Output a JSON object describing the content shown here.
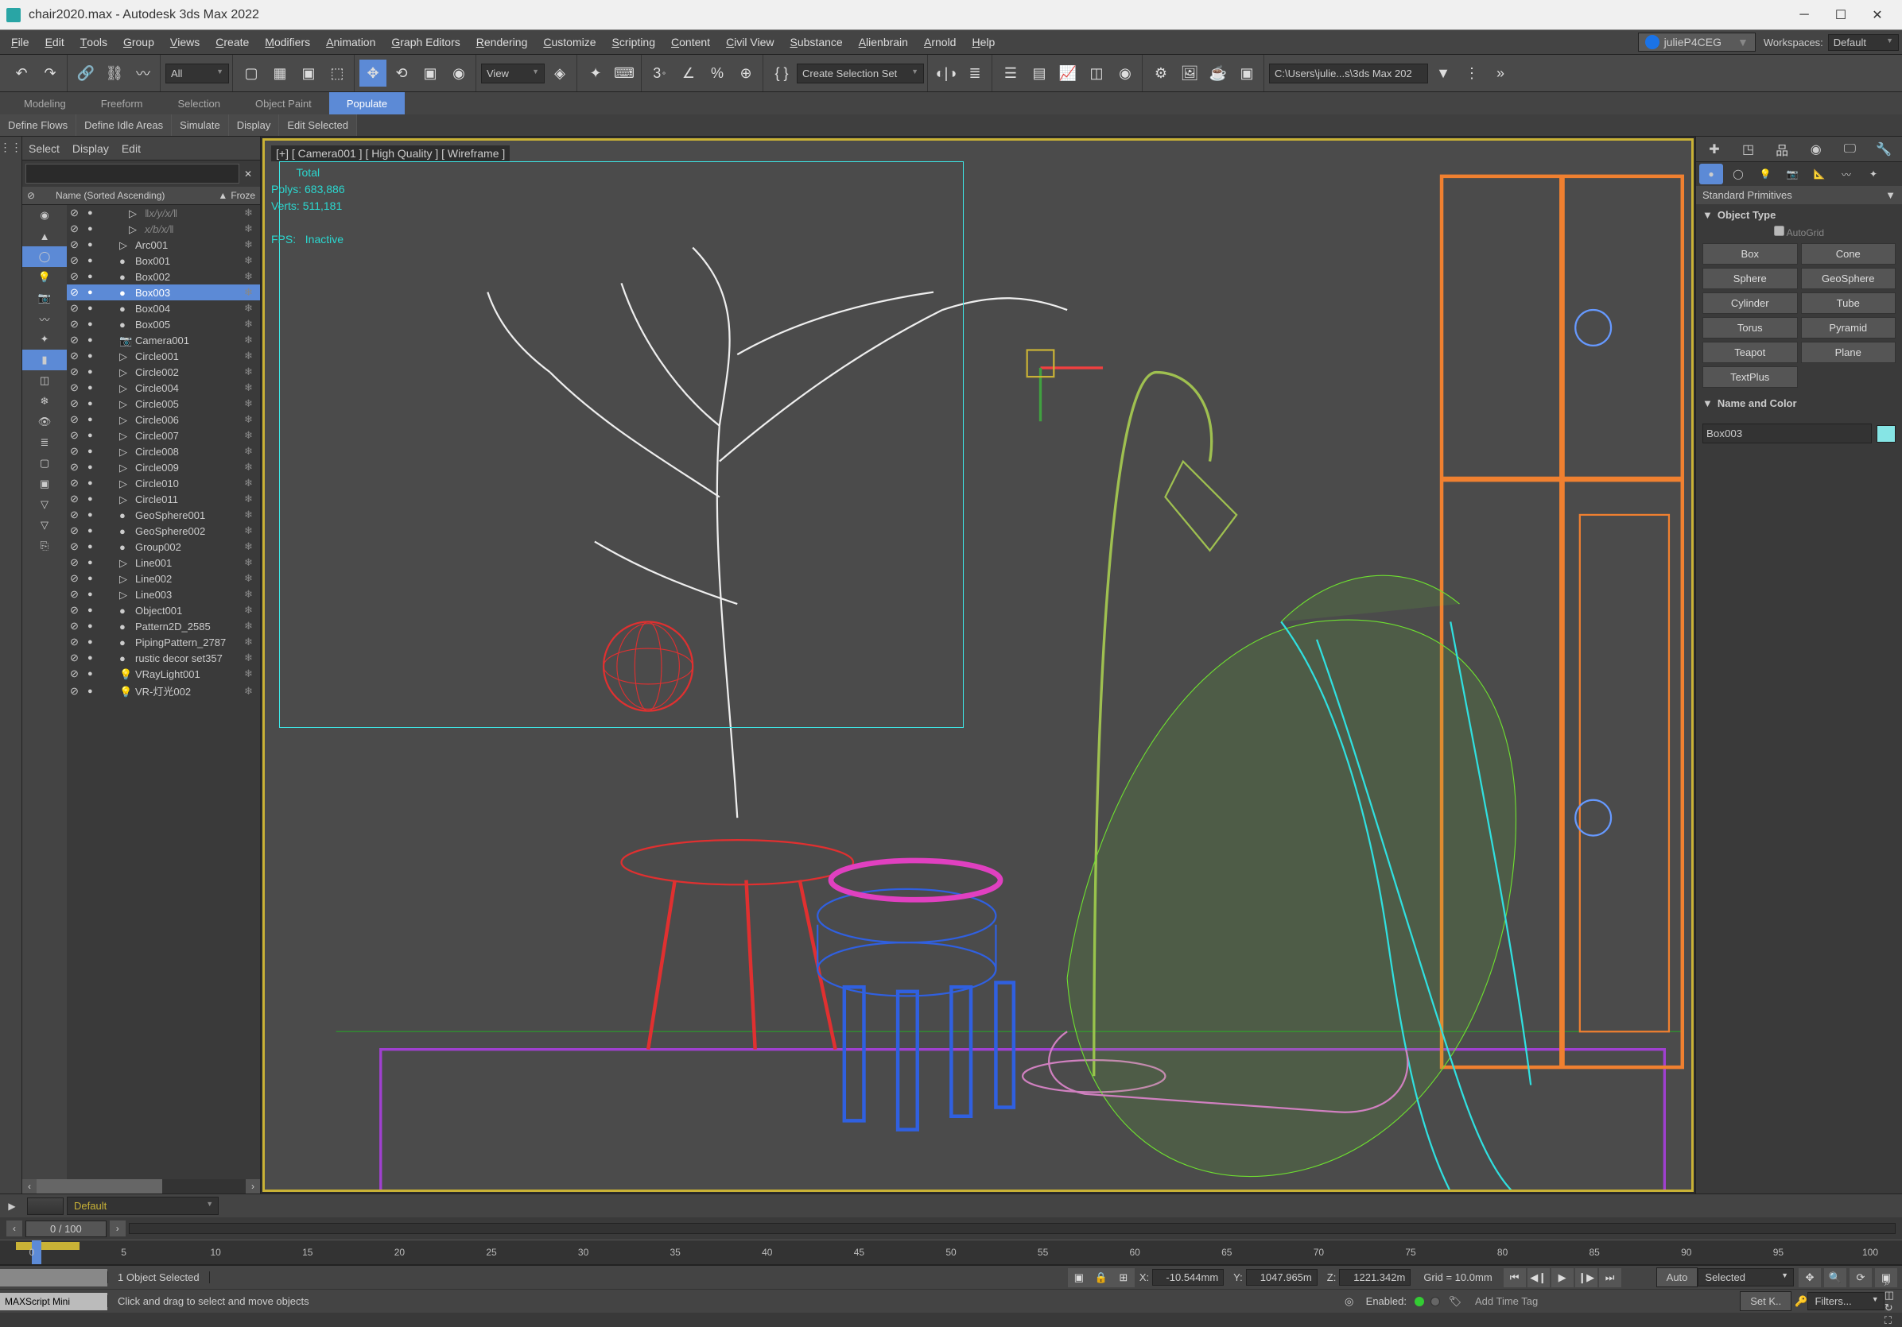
{
  "window": {
    "title": "chair2020.max - Autodesk 3ds Max 2022"
  },
  "menu": [
    "File",
    "Edit",
    "Tools",
    "Group",
    "Views",
    "Create",
    "Modifiers",
    "Animation",
    "Graph Editors",
    "Rendering",
    "Customize",
    "Scripting",
    "Content",
    "Civil View",
    "Substance",
    "Alienbrain",
    "Arnold",
    "Help"
  ],
  "login": {
    "user": "julieP4CEG"
  },
  "workspaces": {
    "label": "Workspaces:",
    "value": "Default"
  },
  "toolbar": {
    "all_dropdown": "All",
    "view_dropdown": "View",
    "create_sel_set": "Create Selection Set",
    "file_path": "C:\\Users\\julie...s\\3ds Max 202"
  },
  "ribbon": {
    "tabs": [
      "Modeling",
      "Freeform",
      "Selection",
      "Object Paint",
      "Populate"
    ],
    "active": "Populate",
    "sub": [
      "Define Flows",
      "Define Idle Areas",
      "Simulate",
      "Display",
      "Edit Selected"
    ]
  },
  "scene_explorer": {
    "menus": [
      "Select",
      "Display",
      "Edit"
    ],
    "col_header": "Name (Sorted Ascending)",
    "col_frozen": "Froze",
    "items": [
      {
        "name": "‖x/y/x/‖",
        "italic": true,
        "selected": false,
        "indent": 2,
        "icon": "tri"
      },
      {
        "name": "x/b/x/‖",
        "italic": true,
        "selected": false,
        "indent": 2,
        "icon": "tri"
      },
      {
        "name": "Arc001",
        "italic": false,
        "selected": false,
        "indent": 1,
        "icon": "tri"
      },
      {
        "name": "Box001",
        "italic": false,
        "selected": false,
        "indent": 1,
        "icon": "dot"
      },
      {
        "name": "Box002",
        "italic": false,
        "selected": false,
        "indent": 1,
        "icon": "dot"
      },
      {
        "name": "Box003",
        "italic": false,
        "selected": true,
        "indent": 1,
        "icon": "dot"
      },
      {
        "name": "Box004",
        "italic": false,
        "selected": false,
        "indent": 1,
        "icon": "dot"
      },
      {
        "name": "Box005",
        "italic": false,
        "selected": false,
        "indent": 1,
        "icon": "dot"
      },
      {
        "name": "Camera001",
        "italic": false,
        "selected": false,
        "indent": 1,
        "icon": "cam"
      },
      {
        "name": "Circle001",
        "italic": false,
        "selected": false,
        "indent": 1,
        "icon": "tri"
      },
      {
        "name": "Circle002",
        "italic": false,
        "selected": false,
        "indent": 1,
        "icon": "tri"
      },
      {
        "name": "Circle004",
        "italic": false,
        "selected": false,
        "indent": 1,
        "icon": "tri"
      },
      {
        "name": "Circle005",
        "italic": false,
        "selected": false,
        "indent": 1,
        "icon": "tri"
      },
      {
        "name": "Circle006",
        "italic": false,
        "selected": false,
        "indent": 1,
        "icon": "tri"
      },
      {
        "name": "Circle007",
        "italic": false,
        "selected": false,
        "indent": 1,
        "icon": "tri"
      },
      {
        "name": "Circle008",
        "italic": false,
        "selected": false,
        "indent": 1,
        "icon": "tri"
      },
      {
        "name": "Circle009",
        "italic": false,
        "selected": false,
        "indent": 1,
        "icon": "tri"
      },
      {
        "name": "Circle010",
        "italic": false,
        "selected": false,
        "indent": 1,
        "icon": "tri"
      },
      {
        "name": "Circle011",
        "italic": false,
        "selected": false,
        "indent": 1,
        "icon": "tri"
      },
      {
        "name": "GeoSphere001",
        "italic": false,
        "selected": false,
        "indent": 1,
        "icon": "dot"
      },
      {
        "name": "GeoSphere002",
        "italic": false,
        "selected": false,
        "indent": 1,
        "icon": "dot"
      },
      {
        "name": "Group002",
        "italic": false,
        "selected": false,
        "indent": 1,
        "icon": "dot"
      },
      {
        "name": "Line001",
        "italic": false,
        "selected": false,
        "indent": 1,
        "icon": "tri"
      },
      {
        "name": "Line002",
        "italic": false,
        "selected": false,
        "indent": 1,
        "icon": "tri"
      },
      {
        "name": "Line003",
        "italic": false,
        "selected": false,
        "indent": 1,
        "icon": "tri"
      },
      {
        "name": "Object001",
        "italic": false,
        "selected": false,
        "indent": 1,
        "icon": "dot"
      },
      {
        "name": "Pattern2D_2585",
        "italic": false,
        "selected": false,
        "indent": 1,
        "icon": "dot"
      },
      {
        "name": "PipingPattern_2787",
        "italic": false,
        "selected": false,
        "indent": 1,
        "icon": "dot"
      },
      {
        "name": "rustic decor set357",
        "italic": false,
        "selected": false,
        "indent": 1,
        "icon": "dot"
      },
      {
        "name": "VRayLight001",
        "italic": false,
        "selected": false,
        "indent": 1,
        "icon": "light"
      },
      {
        "name": "VR-灯光002",
        "italic": false,
        "selected": false,
        "indent": 1,
        "icon": "light"
      }
    ]
  },
  "viewport": {
    "label": "[+] [ Camera001 ] [ High Quality ] [ Wireframe ]",
    "stats_title": "Total",
    "polys_label": "Polys:",
    "polys_val": "683,886",
    "verts_label": "Verts:",
    "verts_val": "511,181",
    "fps_label": "FPS:",
    "fps_val": "Inactive"
  },
  "cmd_panel": {
    "dropdown": "Standard Primitives",
    "obj_type_title": "Object Type",
    "autogrid": "AutoGrid",
    "buttons": [
      "Box",
      "Cone",
      "Sphere",
      "GeoSphere",
      "Cylinder",
      "Tube",
      "Torus",
      "Pyramid",
      "Teapot",
      "Plane",
      "TextPlus"
    ],
    "name_color_title": "Name and Color",
    "obj_name": "Box003"
  },
  "layer_bar": {
    "layer": "Default"
  },
  "time_slider": {
    "frame": "0 / 100"
  },
  "ruler": {
    "ticks": [
      0,
      5,
      10,
      15,
      20,
      25,
      30,
      35,
      40,
      45,
      50,
      55,
      60,
      65,
      70,
      75,
      80,
      85,
      90,
      95,
      100
    ]
  },
  "status": {
    "script_mini": "MAXScript Mini",
    "selected": "1 Object Selected",
    "prompt": "Click and drag to select and move objects",
    "x_label": "X:",
    "x_val": "-10.544mm",
    "y_label": "Y:",
    "y_val": "1047.965m",
    "z_label": "Z:",
    "z_val": "1221.342m",
    "grid": "Grid = 10.0mm",
    "auto": "Auto",
    "selected_dd": "Selected",
    "setk": "Set K..",
    "filters": "Filters...",
    "enabled_label": "Enabled:",
    "time_tag": "Add Time Tag"
  }
}
